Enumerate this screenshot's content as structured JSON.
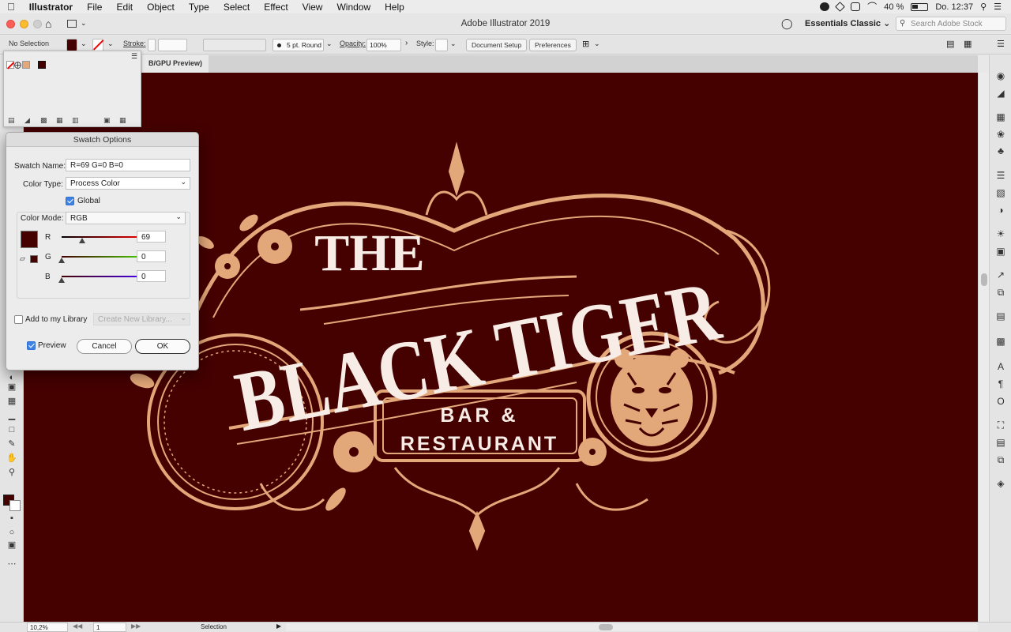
{
  "menubar": {
    "app": "Illustrator",
    "items": [
      "File",
      "Edit",
      "Object",
      "Type",
      "Select",
      "Effect",
      "View",
      "Window",
      "Help"
    ],
    "battery": "40 %",
    "clock": "Do. 12:37"
  },
  "titlebar": {
    "title": "Adobe Illustrator 2019",
    "workspace": "Essentials Classic",
    "search_placeholder": "Search Adobe Stock"
  },
  "control": {
    "selection": "No Selection",
    "stroke_label": "Stroke:",
    "brush": "5 pt. Round",
    "opacity_label": "Opacity:",
    "opacity_value": "100%",
    "style_label": "Style:",
    "document_setup": "Document Setup",
    "preferences": "Preferences"
  },
  "document": {
    "tab_fragment": "B/GPU Preview)"
  },
  "artwork": {
    "line1": "THE",
    "line2": "BLACK TIGER",
    "line3": "BAR &",
    "line4": "RESTAURANT",
    "accent_color": "#e3a87a",
    "text_color": "#f7ede6",
    "background_color": "#450000"
  },
  "dialog": {
    "title": "Swatch Options",
    "swatch_name_label": "Swatch Name:",
    "swatch_name_value": "R=69 G=0 B=0",
    "color_type_label": "Color Type:",
    "color_type_value": "Process Color",
    "global_label": "Global",
    "color_mode_label": "Color Mode:",
    "color_mode_value": "RGB",
    "channels": [
      {
        "name": "R",
        "value": "69",
        "fraction": 0.27,
        "color": "#e00000"
      },
      {
        "name": "G",
        "value": "0",
        "fraction": 0,
        "color": "#00c000"
      },
      {
        "name": "B",
        "value": "0",
        "fraction": 0,
        "color": "#2200dd"
      }
    ],
    "swatch_color": "#450000",
    "add_to_library_label": "Add to my Library",
    "library_placeholder": "Create New Library...",
    "preview_label": "Preview",
    "cancel": "Cancel",
    "ok": "OK"
  },
  "status": {
    "zoom": "10,2%",
    "artboard": "1",
    "tool": "Selection"
  }
}
